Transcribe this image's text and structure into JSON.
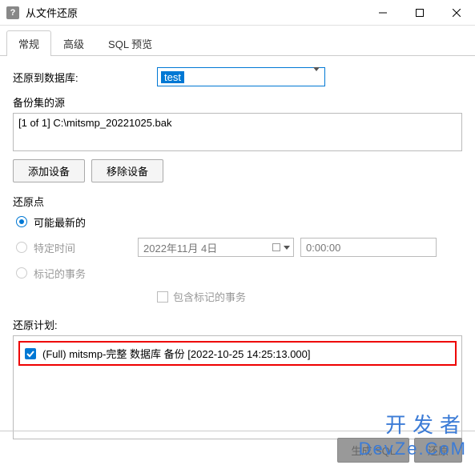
{
  "window": {
    "title": "从文件还原"
  },
  "tabs": {
    "general": "常规",
    "advanced": "高级",
    "sql_preview": "SQL 预览"
  },
  "restore_to": {
    "label": "还原到数据库:",
    "value": "test"
  },
  "backup_source": {
    "label": "备份集的源",
    "item": "[1 of 1] C:\\mitsmp_20221025.bak"
  },
  "buttons": {
    "add_device": "添加设备",
    "remove_device": "移除设备",
    "generate_sql": "生成 SQL",
    "restore": "还原"
  },
  "restore_point": {
    "label": "还原点",
    "latest": "可能最新的",
    "specific_time": "特定时间",
    "marked_tx": "标记的事务",
    "date_value": "2022年11月  4日",
    "time_value": "0:00:00",
    "include_marked": "包含标记的事务"
  },
  "restore_plan": {
    "label": "还原计划:",
    "item": "(Full) mitsmp-完整 数据库 备份 [2022-10-25 14:25:13.000]"
  },
  "watermark": {
    "line1": "开发者",
    "line2": "DevZe.CoM"
  }
}
